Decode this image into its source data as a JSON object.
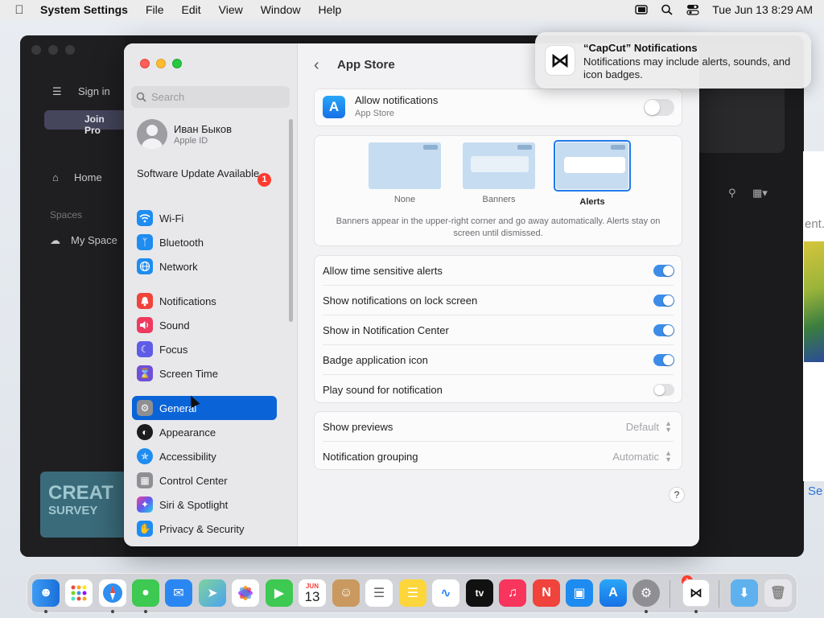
{
  "menubar": {
    "app_name": "System Settings",
    "menus": [
      "File",
      "Edit",
      "View",
      "Window",
      "Help"
    ],
    "clock": "Tue Jun 13  8:29 AM"
  },
  "background_app": {
    "sign_in": "Sign in",
    "join": "Join Pro",
    "home": "Home",
    "spaces": "Spaces",
    "my_space": "My Space",
    "survey_line1": "CREAT",
    "survey_line2": "SURVEY",
    "ent": "ent.",
    "se": "Se"
  },
  "sidebar": {
    "search_placeholder": "Search",
    "user_name": "Иван Быков",
    "user_sub": "Apple ID",
    "software_update": "Software Update Available",
    "update_badge": "1",
    "items": [
      {
        "label": "Wi-Fi",
        "icon": "wifi-icon",
        "color": "#1f8cf0"
      },
      {
        "label": "Bluetooth",
        "icon": "bluetooth-icon",
        "color": "#1f8cf0"
      },
      {
        "label": "Network",
        "icon": "globe-icon",
        "color": "#1f8cf0"
      },
      {
        "label": "Notifications",
        "icon": "bell-icon",
        "color": "#f0433b"
      },
      {
        "label": "Sound",
        "icon": "speaker-icon",
        "color": "#ee3a5f"
      },
      {
        "label": "Focus",
        "icon": "moon-icon",
        "color": "#5e5ce6"
      },
      {
        "label": "Screen Time",
        "icon": "hourglass-icon",
        "color": "#6e4fd8"
      },
      {
        "label": "General",
        "icon": "gear-icon",
        "color": "#8e8e93"
      },
      {
        "label": "Appearance",
        "icon": "appearance-icon",
        "color": "#1c1c1e"
      },
      {
        "label": "Accessibility",
        "icon": "accessibility-icon",
        "color": "#1f8cf0"
      },
      {
        "label": "Control Center",
        "icon": "control-center-icon",
        "color": "#8e8e93"
      },
      {
        "label": "Siri & Spotlight",
        "icon": "siri-icon",
        "color": "#c13be0"
      },
      {
        "label": "Privacy & Security",
        "icon": "hand-icon",
        "color": "#1f8cf0"
      }
    ],
    "active": "General"
  },
  "main": {
    "title": "App Store",
    "allow_title": "Allow notifications",
    "allow_sub": "App Store",
    "allow_enabled": false,
    "styles": [
      {
        "label": "None",
        "selected": false
      },
      {
        "label": "Banners",
        "selected": false
      },
      {
        "label": "Alerts",
        "selected": true
      }
    ],
    "style_description": "Banners appear in the upper-right corner and go away automatically. Alerts stay on screen until dismissed.",
    "toggles": [
      {
        "label": "Allow time sensitive alerts",
        "on": true
      },
      {
        "label": "Show notifications on lock screen",
        "on": true
      },
      {
        "label": "Show in Notification Center",
        "on": true
      },
      {
        "label": "Badge application icon",
        "on": true
      },
      {
        "label": "Play sound for notification",
        "on": false
      }
    ],
    "popups": [
      {
        "label": "Show previews",
        "value": "Default"
      },
      {
        "label": "Notification grouping",
        "value": "Automatic"
      }
    ],
    "help": "?"
  },
  "notification": {
    "title": "“CapCut” Notifications",
    "body": "Notifications may include alerts, sounds, and icon badges."
  },
  "dock": {
    "calendar_month": "JUN",
    "calendar_day": "13",
    "settings_badge": "1",
    "tv_label": "tv"
  }
}
